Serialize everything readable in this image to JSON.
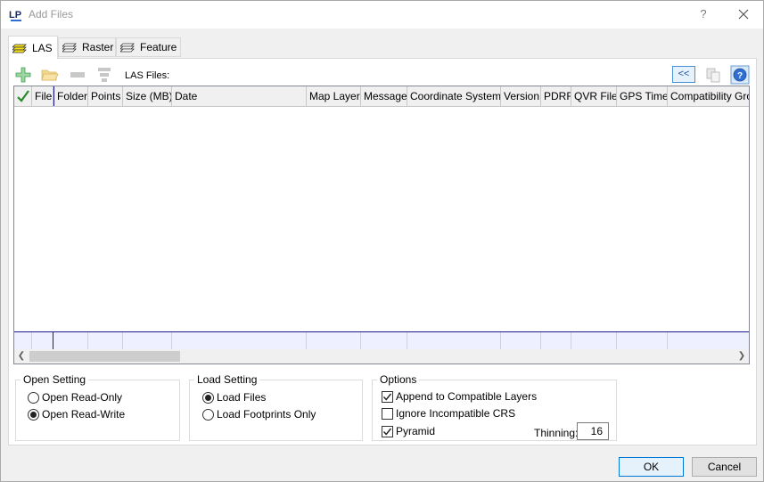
{
  "window": {
    "title": "Add Files",
    "app_icon": "lp-icon",
    "help_glyph": "?",
    "close_icon": "close-icon"
  },
  "tabs": [
    {
      "label": "LAS",
      "icon": "las-layers-icon",
      "active": true
    },
    {
      "label": "Raster",
      "icon": "raster-layers-icon",
      "active": false
    },
    {
      "label": "Feature",
      "icon": "feature-layers-icon",
      "active": false
    }
  ],
  "toolbar": {
    "las_files_label": "LAS Files:",
    "collapse_label": "<<",
    "buttons": [
      "add-icon",
      "open-folder-icon",
      "remove-icon",
      "filter-icon",
      "copy-icon",
      "info-icon"
    ]
  },
  "grid": {
    "columns": [
      "File",
      "Folder",
      "Points",
      "Size (MB)",
      "Date",
      "Map Layer",
      "Message",
      "Coordinate System",
      "Version",
      "PDRF",
      "QVR File",
      "GPS Time",
      "Compatibility Gro"
    ],
    "rows": []
  },
  "open_setting": {
    "legend": "Open Setting",
    "options": [
      {
        "label": "Open Read-Only",
        "selected": false
      },
      {
        "label": "Open Read-Write",
        "selected": true
      }
    ]
  },
  "load_setting": {
    "legend": "Load Setting",
    "options": [
      {
        "label": "Load Files",
        "selected": true
      },
      {
        "label": "Load Footprints Only",
        "selected": false
      }
    ]
  },
  "options": {
    "legend": "Options",
    "checks": [
      {
        "label": "Append to Compatible Layers",
        "checked": true
      },
      {
        "label": "Ignore Incompatible CRS",
        "checked": false
      },
      {
        "label": "Pyramid",
        "checked": true
      }
    ],
    "thinning_label": "Thinning:",
    "thinning_value": "16"
  },
  "buttons": {
    "ok": "OK",
    "cancel": "Cancel"
  },
  "colors": {
    "accent": "#0078d7",
    "add_green": "#3fa34d",
    "grid_footer": "#eef0ff"
  }
}
